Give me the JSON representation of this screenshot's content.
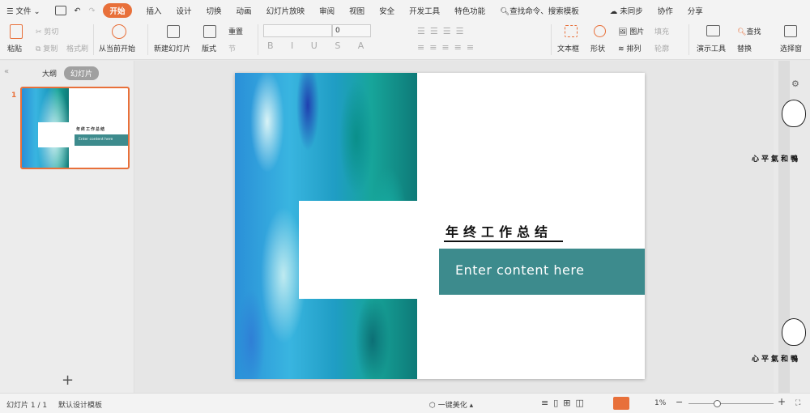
{
  "menu": {
    "file": "文件",
    "tabs": [
      "开始",
      "插入",
      "设计",
      "切换",
      "动画",
      "幻灯片放映",
      "审阅",
      "视图",
      "安全",
      "开发工具",
      "特色功能"
    ],
    "search": "查找命令、搜索模板",
    "sync": "未同步",
    "collab": "协作",
    "share": "分享"
  },
  "ribbon": {
    "paste": "粘贴",
    "cut": "剪切",
    "copy": "复制",
    "format_painter": "格式刷",
    "from_current": "从当前开始",
    "new_slide": "新建幻灯片",
    "layout": "版式",
    "reset": "重置",
    "section": "节",
    "font_size": "0",
    "textbox": "文本框",
    "shape": "形状",
    "picture": "图片",
    "fill": "填充",
    "arrange": "排列",
    "outline": "轮廓",
    "present_tools": "演示工具",
    "find": "查找",
    "replace": "替换",
    "select_pane": "选择窗"
  },
  "leftpanel": {
    "tab_outline": "大纲",
    "tab_slides": "幻灯片",
    "slide_number": "1",
    "add": "+"
  },
  "slide": {
    "title": "年终工作总结",
    "content": "Enter content here"
  },
  "thumb": {
    "title": "年终工作总结",
    "content": "Enter content here"
  },
  "watermark": {
    "text": "心平氣和鴨"
  },
  "status": {
    "slide_count": "幻灯片 1 / 1",
    "template": "默认设计模板",
    "beautify": "一键美化",
    "zoom": "1%"
  },
  "colors": {
    "accent": "#e8703a",
    "teal": "#3d8b8d"
  }
}
